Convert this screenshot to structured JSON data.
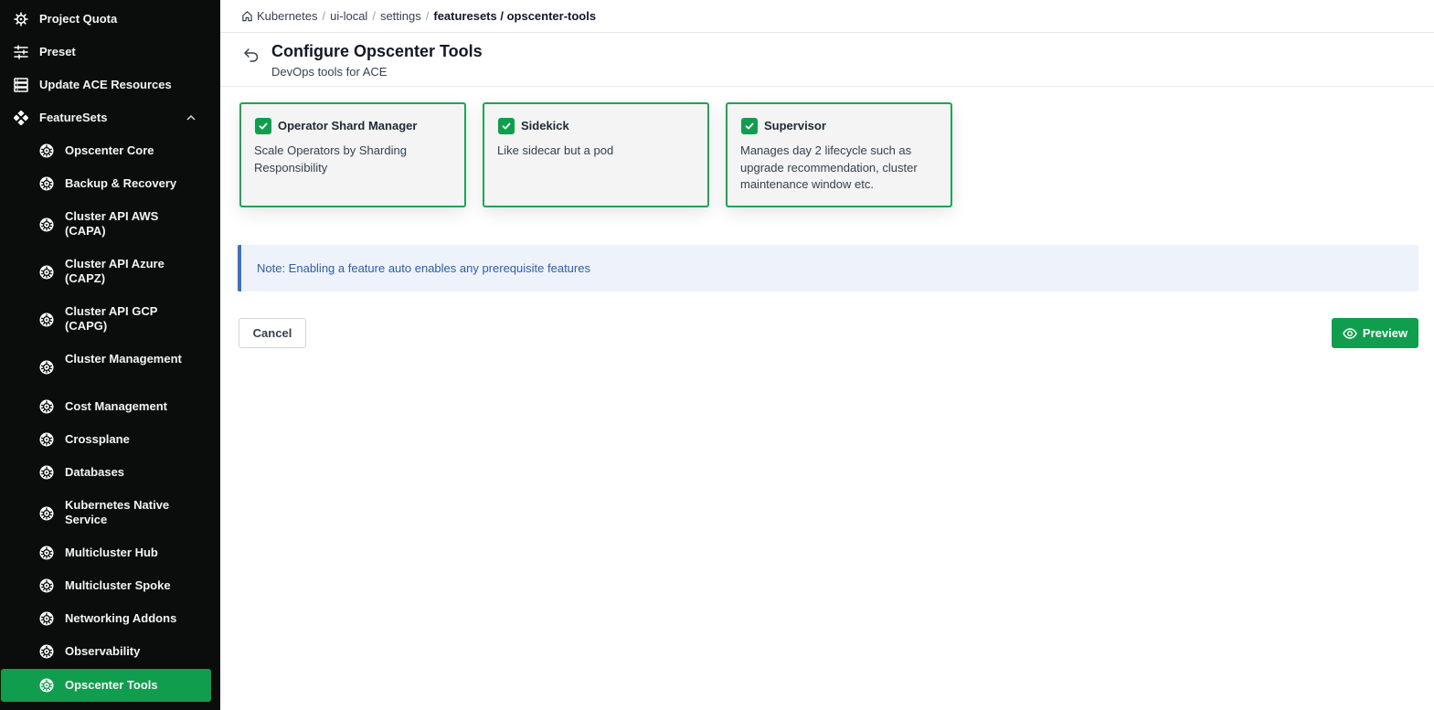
{
  "sidebar": {
    "top_items": [
      {
        "label": "Project Quota",
        "icon": "helm-wheel-icon"
      },
      {
        "label": "Preset",
        "icon": "sliders-icon"
      },
      {
        "label": "Update ACE Resources",
        "icon": "server-icon"
      },
      {
        "label": "FeatureSets",
        "icon": "featuresets-icon",
        "expanded": true
      }
    ],
    "featuresets": [
      {
        "label": "Opscenter Core"
      },
      {
        "label": "Backup & Recovery"
      },
      {
        "label": "Cluster API AWS (CAPA)"
      },
      {
        "label": "Cluster API Azure (CAPZ)"
      },
      {
        "label": "Cluster API GCP (CAPG)"
      },
      {
        "label": "Cluster Management"
      },
      {
        "label": "Cost Management"
      },
      {
        "label": "Crossplane"
      },
      {
        "label": "Databases"
      },
      {
        "label": "Kubernetes Native Service"
      },
      {
        "label": "Multicluster Hub"
      },
      {
        "label": "Multicluster Spoke"
      },
      {
        "label": "Networking Addons"
      },
      {
        "label": "Observability"
      },
      {
        "label": "Opscenter Tools",
        "active": true
      }
    ],
    "active_color": "#109e4e"
  },
  "breadcrumb": {
    "items": [
      "Kubernetes",
      "ui-local",
      "settings",
      "featuresets / opscenter-tools"
    ],
    "separator": "/"
  },
  "header": {
    "title": "Configure Opscenter Tools",
    "subtitle": "DevOps tools for ACE"
  },
  "features": [
    {
      "title": "Operator Shard Manager",
      "description": "Scale Operators by Sharding Responsibility",
      "checked": true
    },
    {
      "title": "Sidekick",
      "description": "Like sidecar but a pod",
      "checked": true
    },
    {
      "title": "Supervisor",
      "description": "Manages day 2 lifecycle such as upgrade recommendation, cluster maintenance window etc.",
      "checked": true
    }
  ],
  "note": "Note: Enabling a feature auto enables any prerequisite features",
  "actions": {
    "cancel_label": "Cancel",
    "preview_label": "Preview"
  },
  "colors": {
    "accent": "#109e4e",
    "sidebar_bg": "#0b0d0c",
    "note_bg": "#eef2fa",
    "note_border": "#3b71ca"
  }
}
